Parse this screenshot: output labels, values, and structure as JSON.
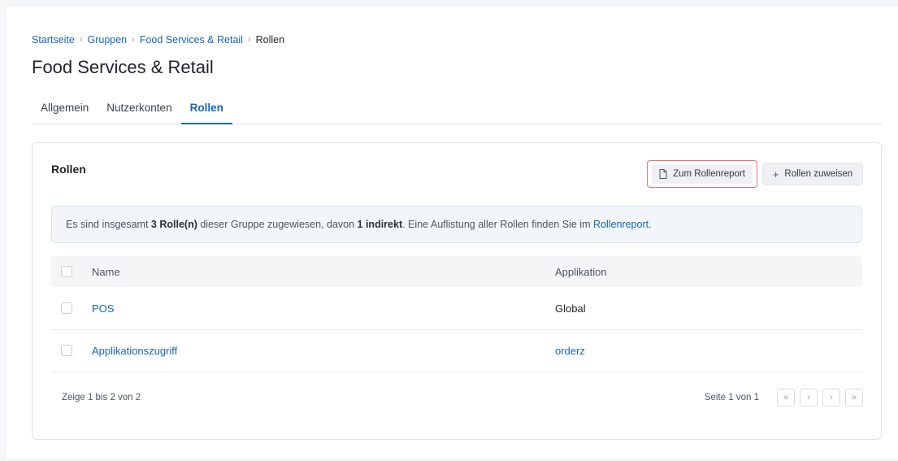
{
  "breadcrumb": {
    "items": [
      "Startseite",
      "Gruppen",
      "Food Services & Retail"
    ],
    "current": "Rollen"
  },
  "page_title": "Food Services & Retail",
  "tabs": [
    {
      "label": "Allgemein",
      "active": false
    },
    {
      "label": "Nutzerkonten",
      "active": false
    },
    {
      "label": "Rollen",
      "active": true
    }
  ],
  "card": {
    "title": "Rollen",
    "report_button": "Zum Rollenreport",
    "assign_button": "Rollen zuweisen"
  },
  "info": {
    "part1": "Es sind insgesamt ",
    "count": "3 Rolle(n)",
    "part2": " dieser Gruppe zugewiesen, davon ",
    "indirect": "1 indirekt",
    "part3": ". Eine Auflistung aller Rollen finden Sie im ",
    "link": "Rollenreport",
    "part4": "."
  },
  "table": {
    "headers": {
      "name": "Name",
      "app": "Applikation"
    },
    "rows": [
      {
        "name": "POS",
        "app": "Global"
      },
      {
        "name": "Applikationszugriff",
        "app": "orderz"
      }
    ]
  },
  "pagination": {
    "summary": "Zeige 1 bis 2 von 2",
    "page_text": "Seite 1 von 1",
    "first": "«",
    "prev": "‹",
    "next": "›",
    "last": "»"
  },
  "colors": {
    "link": "#1565c0",
    "highlight_border": "#e57373"
  }
}
